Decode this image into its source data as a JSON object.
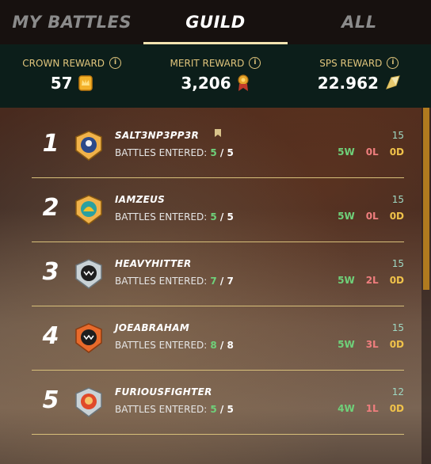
{
  "tabs": [
    {
      "label": "MY BATTLES",
      "active": false
    },
    {
      "label": "GUILD",
      "active": true
    },
    {
      "label": "ALL",
      "active": false
    }
  ],
  "rewards": [
    {
      "title": "CROWN REWARD",
      "value": "57",
      "icon": "crown-token-icon"
    },
    {
      "title": "MERIT REWARD",
      "value": "3,206",
      "icon": "merit-medal-icon"
    },
    {
      "title": "SPS REWARD",
      "value": "22.962",
      "icon": "sps-crystal-icon"
    }
  ],
  "battles_label": "BATTLES ENTERED:",
  "rows": [
    {
      "rank": "1",
      "name": "SALT3NP3PP3R",
      "entered": "5",
      "total": "5",
      "score": "15",
      "w": "5W",
      "l": "0L",
      "d": "0D",
      "bookmark": true
    },
    {
      "rank": "2",
      "name": "IAMZEUS",
      "entered": "5",
      "total": "5",
      "score": "15",
      "w": "5W",
      "l": "0L",
      "d": "0D",
      "bookmark": false
    },
    {
      "rank": "3",
      "name": "HEAVYHITTER",
      "entered": "7",
      "total": "7",
      "score": "15",
      "w": "5W",
      "l": "2L",
      "d": "0D",
      "bookmark": false
    },
    {
      "rank": "4",
      "name": "JOEABRAHAM",
      "entered": "8",
      "total": "8",
      "score": "15",
      "w": "5W",
      "l": "3L",
      "d": "0D",
      "bookmark": false
    },
    {
      "rank": "5",
      "name": "FURIOUSFIGHTER",
      "entered": "5",
      "total": "5",
      "score": "12",
      "w": "4W",
      "l": "1L",
      "d": "0D",
      "bookmark": false
    }
  ],
  "colors": {
    "accent_gold": "#e0c57c",
    "win": "#6fd17a",
    "loss": "#ef7e7e",
    "draw": "#f0c24a",
    "reward_bar": "#0c1e1a"
  }
}
